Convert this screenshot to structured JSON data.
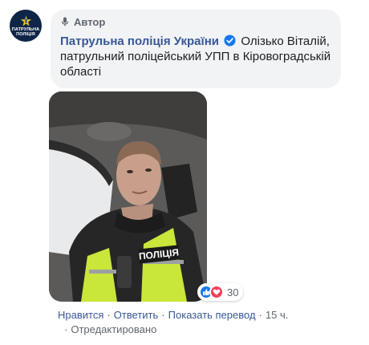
{
  "avatar": {
    "text_line1": "ПАТРУЛЬНА",
    "text_line2": "ПОЛІЦІЯ"
  },
  "comment": {
    "author_badge": "Автор",
    "page_name": "Патрульна поліція України",
    "text": "Олізько Віталій, патрульний поліцейський УПП в Кіровоградській області"
  },
  "photo": {
    "vest_text": "ПОЛІЦІЯ"
  },
  "reactions": {
    "count": "30",
    "types": [
      "like",
      "love"
    ]
  },
  "actions": {
    "like": "Нравится",
    "reply": "Ответить",
    "translate": "Показать перевод",
    "time": "15 ч.",
    "edited": "Отредактировано"
  },
  "colors": {
    "link": "#385898",
    "bubble": "#f2f3f5",
    "meta": "#606770",
    "like": "#1877f2",
    "love": "#f33e58",
    "avatar_bg": "#0f2548"
  }
}
